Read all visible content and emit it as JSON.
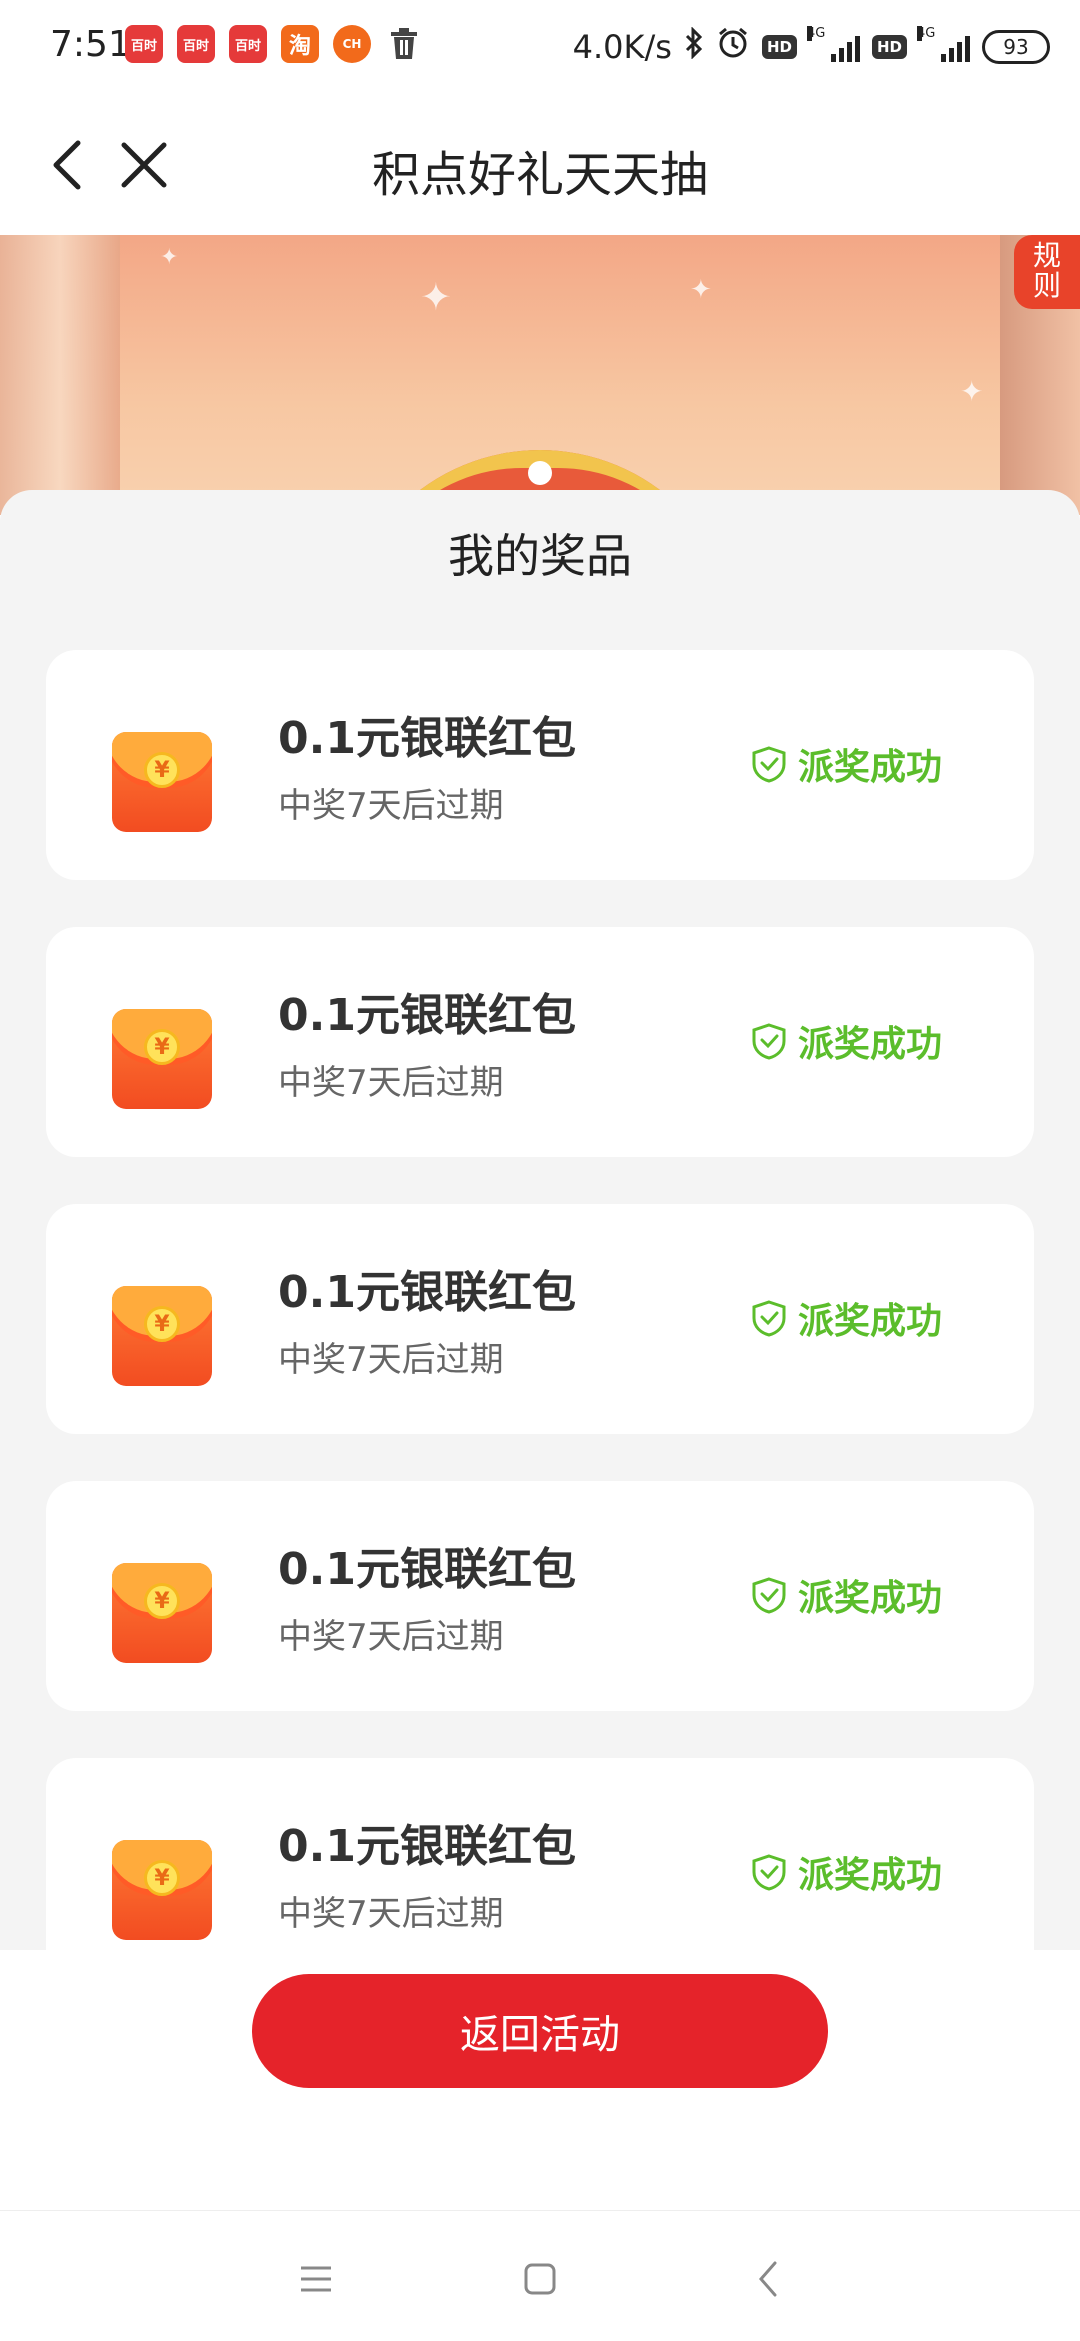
{
  "status_bar": {
    "time": "7:51",
    "app_icons": [
      {
        "label": "百时",
        "color": "#e53a3a"
      },
      {
        "label": "百时",
        "color": "#e53a3a"
      },
      {
        "label": "百时",
        "color": "#e53a3a"
      },
      {
        "label": "淘",
        "color": "#f26a1b"
      },
      {
        "label": "CH",
        "color": "#f26a1b"
      }
    ],
    "net_speed": "4.0K/s",
    "hd_label": "HD",
    "network_type": "4G",
    "battery": "93"
  },
  "title_bar": {
    "title": "积点好礼天天抽"
  },
  "banner": {
    "rules_label": "规\n则"
  },
  "prize_sheet": {
    "title": "我的奖品",
    "prizes": [
      {
        "name": "0.1元银联红包",
        "expire": "中奖7天后过期",
        "status": "派奖成功"
      },
      {
        "name": "0.1元银联红包",
        "expire": "中奖7天后过期",
        "status": "派奖成功"
      },
      {
        "name": "0.1元银联红包",
        "expire": "中奖7天后过期",
        "status": "派奖成功"
      },
      {
        "name": "0.1元银联红包",
        "expire": "中奖7天后过期",
        "status": "派奖成功"
      },
      {
        "name": "0.1元银联红包",
        "expire": "中奖7天后过期",
        "status": "派奖成功"
      }
    ],
    "coin_symbol": "¥"
  },
  "actions": {
    "return_label": "返回活动"
  },
  "colors": {
    "accent_red": "#e5232a",
    "success_green": "#5bbd2b",
    "sheet_bg": "#f4f4f4"
  }
}
